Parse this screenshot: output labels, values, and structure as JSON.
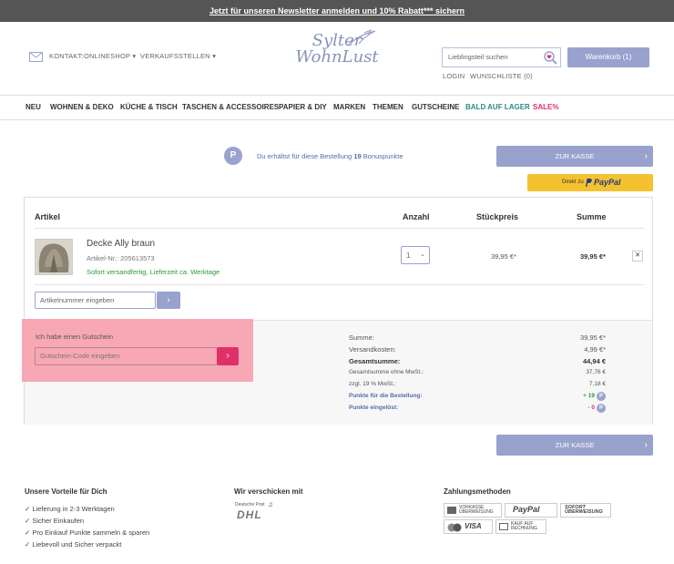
{
  "topbar": {
    "text": "Jetzt für unseren Newsletter anmelden und 10% Rabatt*** sichern"
  },
  "header": {
    "contact_label": "KONTAKT:",
    "onlineshop": "ONLINESHOP",
    "verkaufsstellen": "VERKAUFSSTELLEN",
    "logo_line1": "Sylter",
    "logo_line2": "WohnLust",
    "search_placeholder": "Lieblingsteil suchen",
    "cart_button": "Warenkorb (1)",
    "login": "LOGIN",
    "wishlist": "WUNSCHLISTE (0)"
  },
  "nav": [
    {
      "label": "NEU",
      "color": "#333333"
    },
    {
      "label": "WOHNEN & DEKO",
      "color": "#333333"
    },
    {
      "label": "KÜCHE & TISCH",
      "color": "#333333"
    },
    {
      "label": "TASCHEN & ACCESSOIRES",
      "color": "#333333"
    },
    {
      "label": "PAPIER & DIY",
      "color": "#333333"
    },
    {
      "label": "MARKEN",
      "color": "#333333"
    },
    {
      "label": "THEMEN",
      "color": "#333333"
    },
    {
      "label": "GUTSCHEINE",
      "color": "#333333"
    },
    {
      "label": "BALD AUF LAGER",
      "color": "#2e8a8a"
    },
    {
      "label": "SALE%",
      "color": "#e0306a"
    }
  ],
  "bonus": {
    "icon_letter": "P",
    "text_before": "Du erhältst für diese Bestellung",
    "points": "19",
    "text_after": "Bonuspunkte"
  },
  "checkout": {
    "button_label": "ZUR KASSE",
    "paypal_prefix": "Direkt zu",
    "paypal_brand": "PayPal"
  },
  "table": {
    "headers": {
      "article": "Artikel",
      "quantity": "Anzahl",
      "unit_price": "Stückpreis",
      "total": "Summe"
    },
    "item": {
      "name": "Decke Ally braun",
      "sku": "Artikel-Nr.: 205613573",
      "delivery": "Sofort versandfertig, Lieferzeit ca. Werktage",
      "quantity": "1",
      "unit_price": "39,95 €*",
      "total": "39,95 €*",
      "remove": "✕"
    },
    "article_number_placeholder": "Artikelnummer eingeben"
  },
  "voucher": {
    "label": "Ich habe einen Gutschein",
    "placeholder": "Gutschein-Code eingeben",
    "highlight_color": "#f7a8b4"
  },
  "summary": [
    {
      "label": "Summe:",
      "value": "39,95 €*",
      "bold": false
    },
    {
      "label": "Versandkosten:",
      "value": "4,99 €*",
      "bold": false
    },
    {
      "label": "Gesamtsumme:",
      "value": "44,94 €",
      "bold": true
    },
    {
      "label": "Gesamtsumme ohne MwSt.:",
      "value": "37,76 €",
      "bold": false
    },
    {
      "label": "zzgl. 19 % MwSt.:",
      "value": "7,18 €",
      "bold": false
    }
  ],
  "points_rows": {
    "earned_label": "Punkte für die Bestellung:",
    "earned_value": "+ 19",
    "redeemed_label": "Punkte eingelöst:",
    "redeemed_value": "- 0"
  },
  "footer": {
    "advantages_title": "Unsere Vorteile für Dich",
    "advantages": [
      "Lieferung in 2-3 Werktagen",
      "Sicher Einkaufen",
      "Pro Einkauf Punkte sammeln & sparen",
      "Liebevoll und Sicher verpackt"
    ],
    "shipping_title": "Wir verschicken mit",
    "dhl_small": "Deutsche Post",
    "dhl": "DHL",
    "payment_title": "Zahlungsmethoden",
    "payments": [
      "VORKASSE ÜBERWEISUNG",
      "PayPal",
      "SOFORT ÜBERWEISUNG",
      "VISA",
      "KAUF AUF RECHNUNG"
    ]
  }
}
